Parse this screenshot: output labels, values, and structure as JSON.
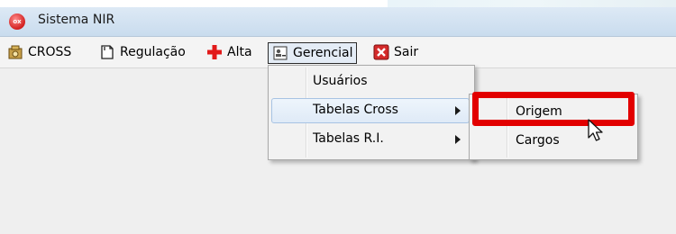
{
  "window": {
    "title": "Sistema NIR",
    "app_icon_text": "ox"
  },
  "menubar": {
    "items": [
      {
        "label": "CROSS",
        "icon": "cross-icon"
      },
      {
        "label": "Regulação",
        "icon": "document-icon"
      },
      {
        "label": "Alta",
        "icon": "red-plus-icon"
      },
      {
        "label": "Gerencial",
        "icon": "manager-icon",
        "active": true
      },
      {
        "label": "Sair",
        "icon": "exit-icon"
      }
    ]
  },
  "gerencial_menu": {
    "items": [
      {
        "label": "Usuários",
        "has_submenu": false
      },
      {
        "label": "Tabelas Cross",
        "has_submenu": true,
        "highlighted": true
      },
      {
        "label": "Tabelas R.I.",
        "has_submenu": true
      }
    ]
  },
  "tabelas_cross_submenu": {
    "items": [
      {
        "label": "Origem",
        "emphasized": true
      },
      {
        "label": "Cargos"
      }
    ]
  },
  "colors": {
    "highlight_box": "#e20000",
    "menu_background": "#f2f2f2",
    "titlebar": "#c9dcee"
  }
}
